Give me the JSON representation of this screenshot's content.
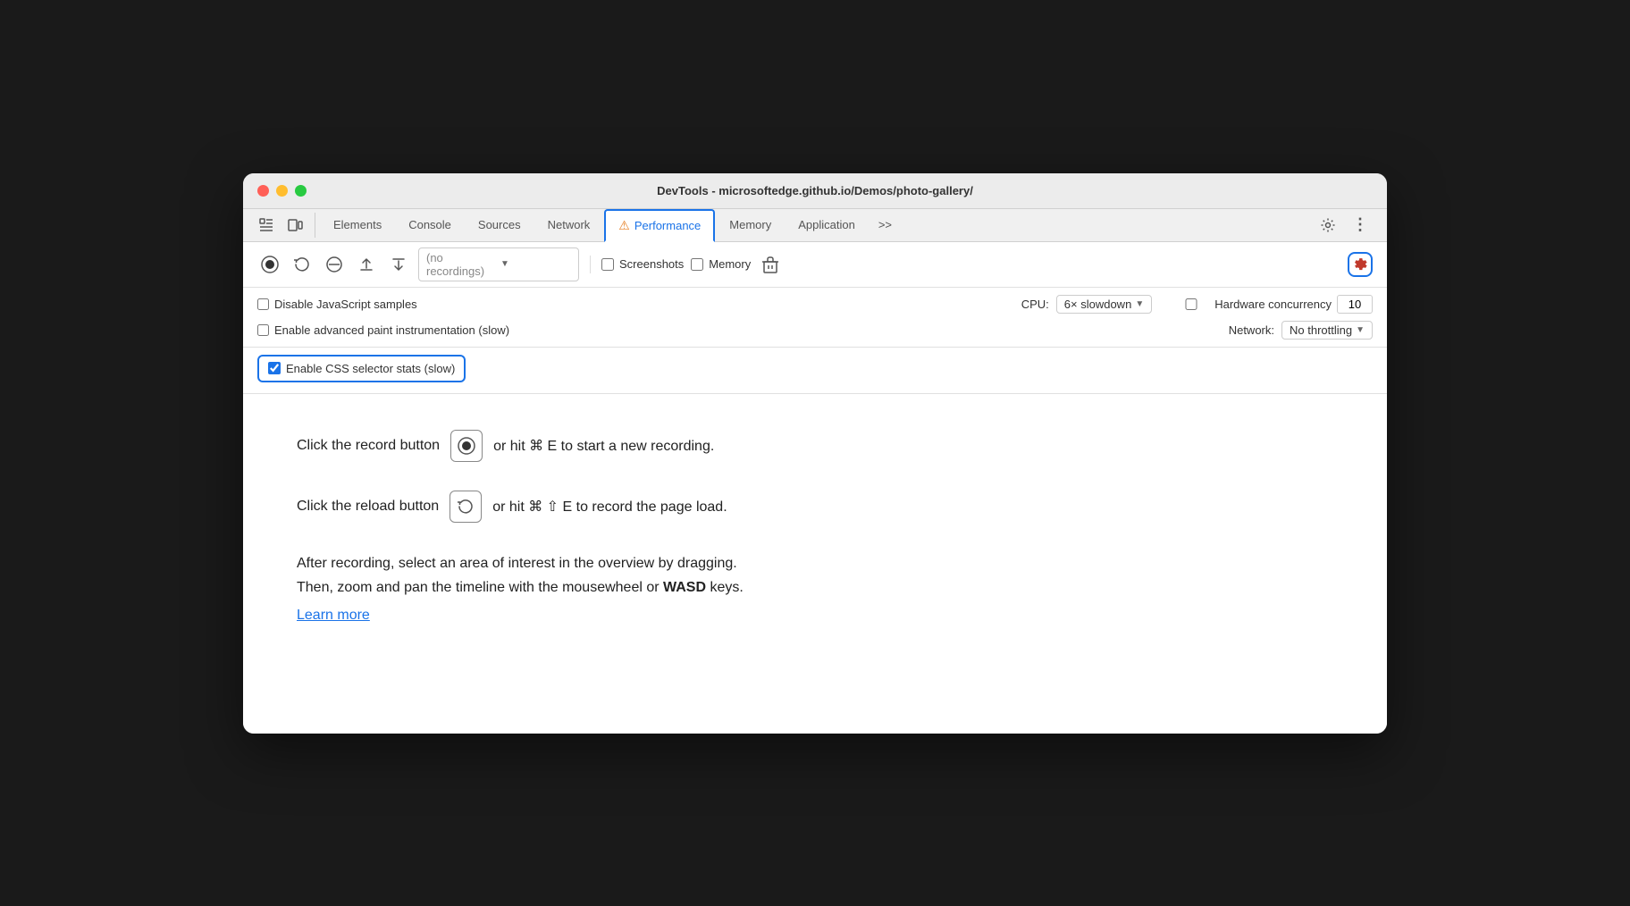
{
  "window": {
    "title": "DevTools - microsoftedge.github.io/Demos/photo-gallery/"
  },
  "tabs": [
    {
      "id": "elements",
      "label": "Elements",
      "active": false
    },
    {
      "id": "console",
      "label": "Console",
      "active": false
    },
    {
      "id": "sources",
      "label": "Sources",
      "active": false
    },
    {
      "id": "network",
      "label": "Network",
      "active": false
    },
    {
      "id": "performance",
      "label": "Performance",
      "active": true,
      "warning": true
    },
    {
      "id": "memory",
      "label": "Memory",
      "active": false
    },
    {
      "id": "application",
      "label": "Application",
      "active": false
    }
  ],
  "toolbar": {
    "more_label": ">>",
    "settings_tooltip": "Settings",
    "more_options_tooltip": "More options",
    "recordings_placeholder": "(no recordings)",
    "screenshots_label": "Screenshots",
    "memory_label": "Memory"
  },
  "settings": {
    "disable_js_samples_label": "Disable JavaScript samples",
    "enable_advanced_paint_label": "Enable advanced paint instrumentation (slow)",
    "enable_css_stats_label": "Enable CSS selector stats (slow)",
    "cpu_label": "CPU:",
    "cpu_value": "6× slowdown",
    "hardware_concurrency_label": "Hardware concurrency",
    "hardware_concurrency_value": "10",
    "network_label": "Network:",
    "network_value": "No throttling"
  },
  "instructions": {
    "record_text_before": "Click the record button",
    "record_text_after": "or hit ⌘ E to start a new recording.",
    "reload_text_before": "Click the reload button",
    "reload_text_after": "or hit ⌘ ⇧ E to record the page load.",
    "description_line1": "After recording, select an area of interest in the overview by dragging.",
    "description_line2": "Then, zoom and pan the timeline with the mousewheel or",
    "description_bold": "WASD",
    "description_line2_end": "keys.",
    "learn_more": "Learn more"
  },
  "colors": {
    "accent": "#1a73e8",
    "warning": "#e67e22",
    "border": "#d0d0d0",
    "text": "#333333"
  }
}
